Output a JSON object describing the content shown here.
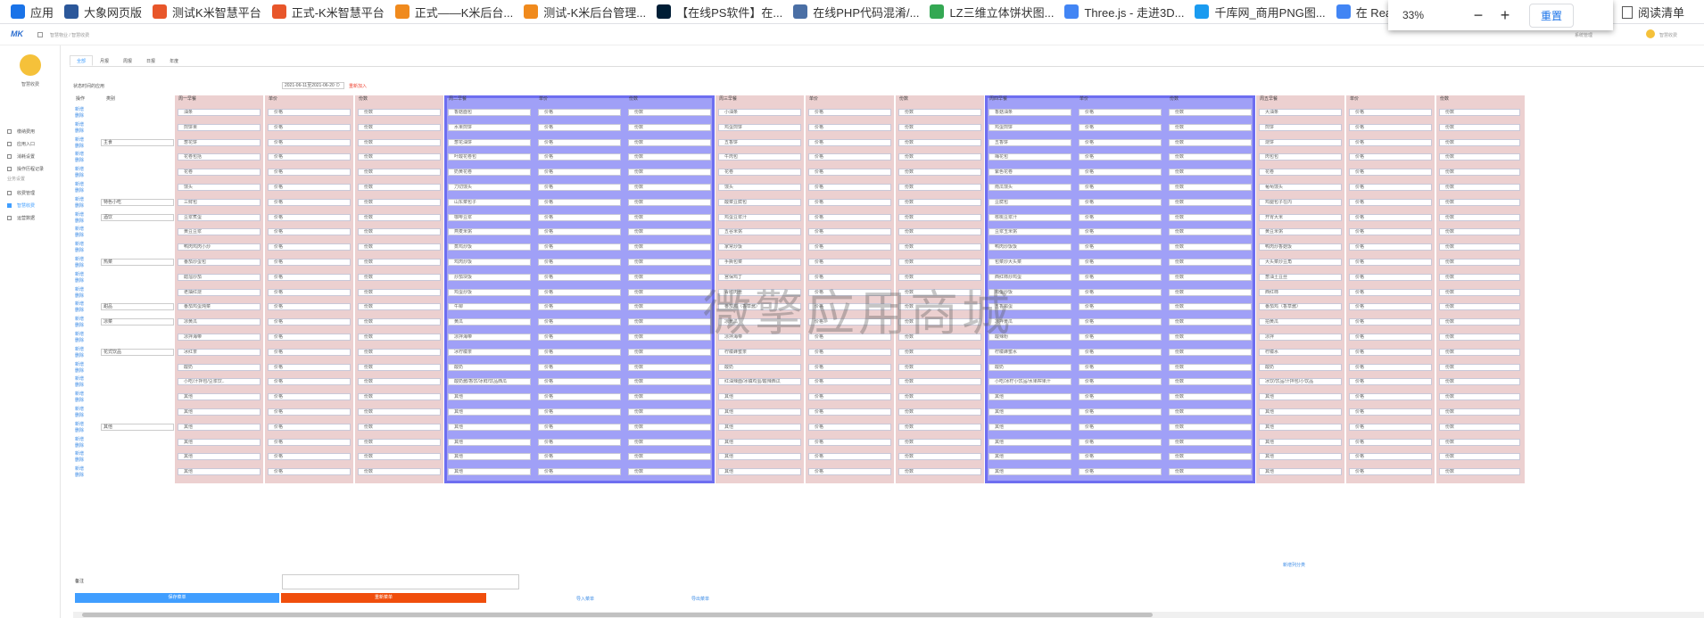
{
  "browser": {
    "bookmarks": [
      {
        "label": "应用",
        "icon": "apps-grid-icon",
        "color": "#1a73e8"
      },
      {
        "label": "大象网页版",
        "icon": "m-logo-icon",
        "color": "#2b579a"
      },
      {
        "label": "测试K米智慧平台",
        "icon": "km-logo-icon",
        "color": "#e8562a"
      },
      {
        "label": "正式-K米智慧平台",
        "icon": "km-logo-icon",
        "color": "#e8562a"
      },
      {
        "label": "正式——K米后台...",
        "icon": "km-square-icon",
        "color": "#f08a1d"
      },
      {
        "label": "测试-K米后台管理...",
        "icon": "km-square-icon",
        "color": "#f08a1d"
      },
      {
        "label": "【在线PS软件】在...",
        "icon": "ps-logo-icon",
        "color": "#001e36"
      },
      {
        "label": "在线PHP代码混淆/...",
        "icon": "php-logo-icon",
        "color": "#4a6fa5"
      },
      {
        "label": "LZ三维立体饼状图...",
        "icon": "page-icon",
        "color": "#34a853"
      },
      {
        "label": "Three.js - 走进3D...",
        "icon": "threejs-icon",
        "color": "#4285f4"
      },
      {
        "label": "千库网_商用PNG图...",
        "icon": "k-logo-icon",
        "color": "#1a9bf0"
      },
      {
        "label": "在 React",
        "icon": "react-icon",
        "color": "#4285f4"
      }
    ],
    "reading_list": "阅读清单"
  },
  "zoom": {
    "percent": "33%",
    "minus": "−",
    "plus": "+",
    "reset": "重置"
  },
  "topbar": {
    "logo": "MK",
    "breadcrumb": "智慧物业 / 智慧收费",
    "user_menu": "系统管理",
    "right_user": "智慧收费"
  },
  "sidebar": {
    "name": "智慧收费",
    "items": [
      "缴纳费用",
      "应用入口",
      "消耗设置",
      "操作历程记录",
      "收费管理",
      "智慧收费",
      "运营数据"
    ],
    "group": "业务设置"
  },
  "main": {
    "tabs": [
      "全部",
      "月报",
      "周报",
      "日报",
      "年度"
    ],
    "period_label": "状态时间的应用",
    "date_range": "2021-06-11至2021-06-20 ⊙",
    "reset_link": "重新加入",
    "col_op": "操作",
    "col_type": "类别",
    "meals": [
      {
        "name": "周一早餐",
        "c2": "单价",
        "c3": "份数",
        "blue": false
      },
      {
        "name": "周二早餐",
        "c2": "单价",
        "c3": "份数",
        "blue": true
      },
      {
        "name": "周三早餐",
        "c2": "单价",
        "c3": "份数",
        "blue": false
      },
      {
        "name": "周四早餐",
        "c2": "单价",
        "c3": "份数",
        "blue": true
      },
      {
        "name": "周五早餐",
        "c2": "单价",
        "c3": "份数",
        "blue": false
      }
    ],
    "op_label": "新增\n删除",
    "types": [
      {
        "label": "主食",
        "row": 2
      },
      {
        "label": "特色小吃",
        "row": 6
      },
      {
        "label": "酒饮",
        "row": 7
      },
      {
        "label": "热菜",
        "row": 10
      },
      {
        "label": "甜品",
        "row": 13
      },
      {
        "label": "凉菜",
        "row": 14
      },
      {
        "label": "花式饮品",
        "row": 16
      },
      {
        "label": "其他",
        "row": 21
      }
    ],
    "rows": [
      [
        "油条",
        "香菇面包",
        "小油条",
        "香菇油条",
        "大油条"
      ],
      [
        "煎饼果",
        "水果煎饼",
        "鸡蛋煎饼",
        "鸡蛋煎饼",
        "煎饼"
      ],
      [
        "葱花饼",
        "葱花油饼",
        "五香饼",
        "五香饼",
        "烧饼"
      ],
      [
        "花卷包括",
        "叶酸花卷包",
        "牛肉包",
        "梅花包",
        "肉包包"
      ],
      [
        "花卷",
        "奶黄花卷",
        "花卷",
        "紫色花卷",
        "花卷"
      ],
      [
        "馒头",
        "刀切馒头",
        "馒头",
        "南瓜馒头",
        "葡萄馒头"
      ],
      [
        "三鲜包",
        "山东菜包子",
        "酸菜豆腐包",
        "豆腐包",
        "鸡腿包子在内"
      ],
      [
        "豆浆煮蛋",
        "咖啡豆浆",
        "鸡蛋豆浆汁",
        "核桃豆浆汁",
        "开胃大米"
      ],
      [
        "黄豆豆浆",
        "燕麦米粥",
        "五谷米粥",
        "豆浆玉米粥",
        "黄豆米粥"
      ],
      [
        "鸭肉鸡肉小炒",
        "蒸鸡炒饭",
        "家常炒饭",
        "鸭肉炒饭饭",
        "鸭肉炒香菇饭"
      ],
      [
        "番茄炒蛋包",
        "鸡肉炒饭",
        "手撕包菜",
        "包菜炒大头菜",
        "大头菜炒豆角"
      ],
      [
        "醋溜炒茄",
        "炒茄块饭",
        "宫保鸡丁",
        "西红柿炒鸡蛋",
        "葱油土豆丝"
      ],
      [
        "老抽红烧",
        "鸡蛋炒饭",
        "青椒肉丝",
        "鸡蛋炒饭",
        "西红柿"
      ],
      [
        "番茄鸡蛋炖菜",
        "牛柳",
        "番茄鸡（香草酱）",
        "五香鸡蛋",
        "番茄鸡（香草酱）"
      ],
      [
        "凉黄瓜",
        "黄瓜",
        "凉黄瓜",
        "凉拌黄瓜",
        "拍黄瓜"
      ],
      [
        "凉拌海带",
        "凉拌海带",
        "凉拌海带",
        "酸辣粉",
        "凉拌"
      ],
      [
        "冰红茶",
        "冰柠檬茶",
        "柠檬蜂蜜茶",
        "柠檬蜂蜜水",
        "柠檬水"
      ],
      [
        "酸奶",
        "酸奶",
        "酸奶",
        "酸奶",
        "酸奶"
      ],
      [
        "小吃/汗拌包/豆浆饮..",
        "酸奶酱/香饮/冰鲜/饮品西瓜",
        "红油辣面/冰镇鸡蛋/酸辣西瓜",
        "小吃/冰柠小饮品/水果榨果汁",
        "冰饮/饮品/汗拌包/小饮品"
      ],
      [
        "其他",
        "其他",
        "其他",
        "其他",
        "其他"
      ],
      [
        "其他",
        "其他",
        "其他",
        "其他",
        "其他"
      ],
      [
        "其他",
        "其他",
        "其他",
        "其他",
        "其他"
      ],
      [
        "其他",
        "其他",
        "其他",
        "其他",
        "其他"
      ],
      [
        "其他",
        "其他",
        "其他",
        "其他",
        "其他"
      ],
      [
        "其他",
        "其他",
        "其他",
        "其他",
        "其他"
      ]
    ],
    "price_ph": "价格",
    "qty_ph": "份数",
    "add_column": "新增列分类",
    "remark_label": "备注",
    "btn_save": "保存菜单",
    "btn_reset": "重新菜单",
    "link_import": "导入菜单",
    "link_export": "导出菜单"
  },
  "watermark": "微擎应用商城"
}
